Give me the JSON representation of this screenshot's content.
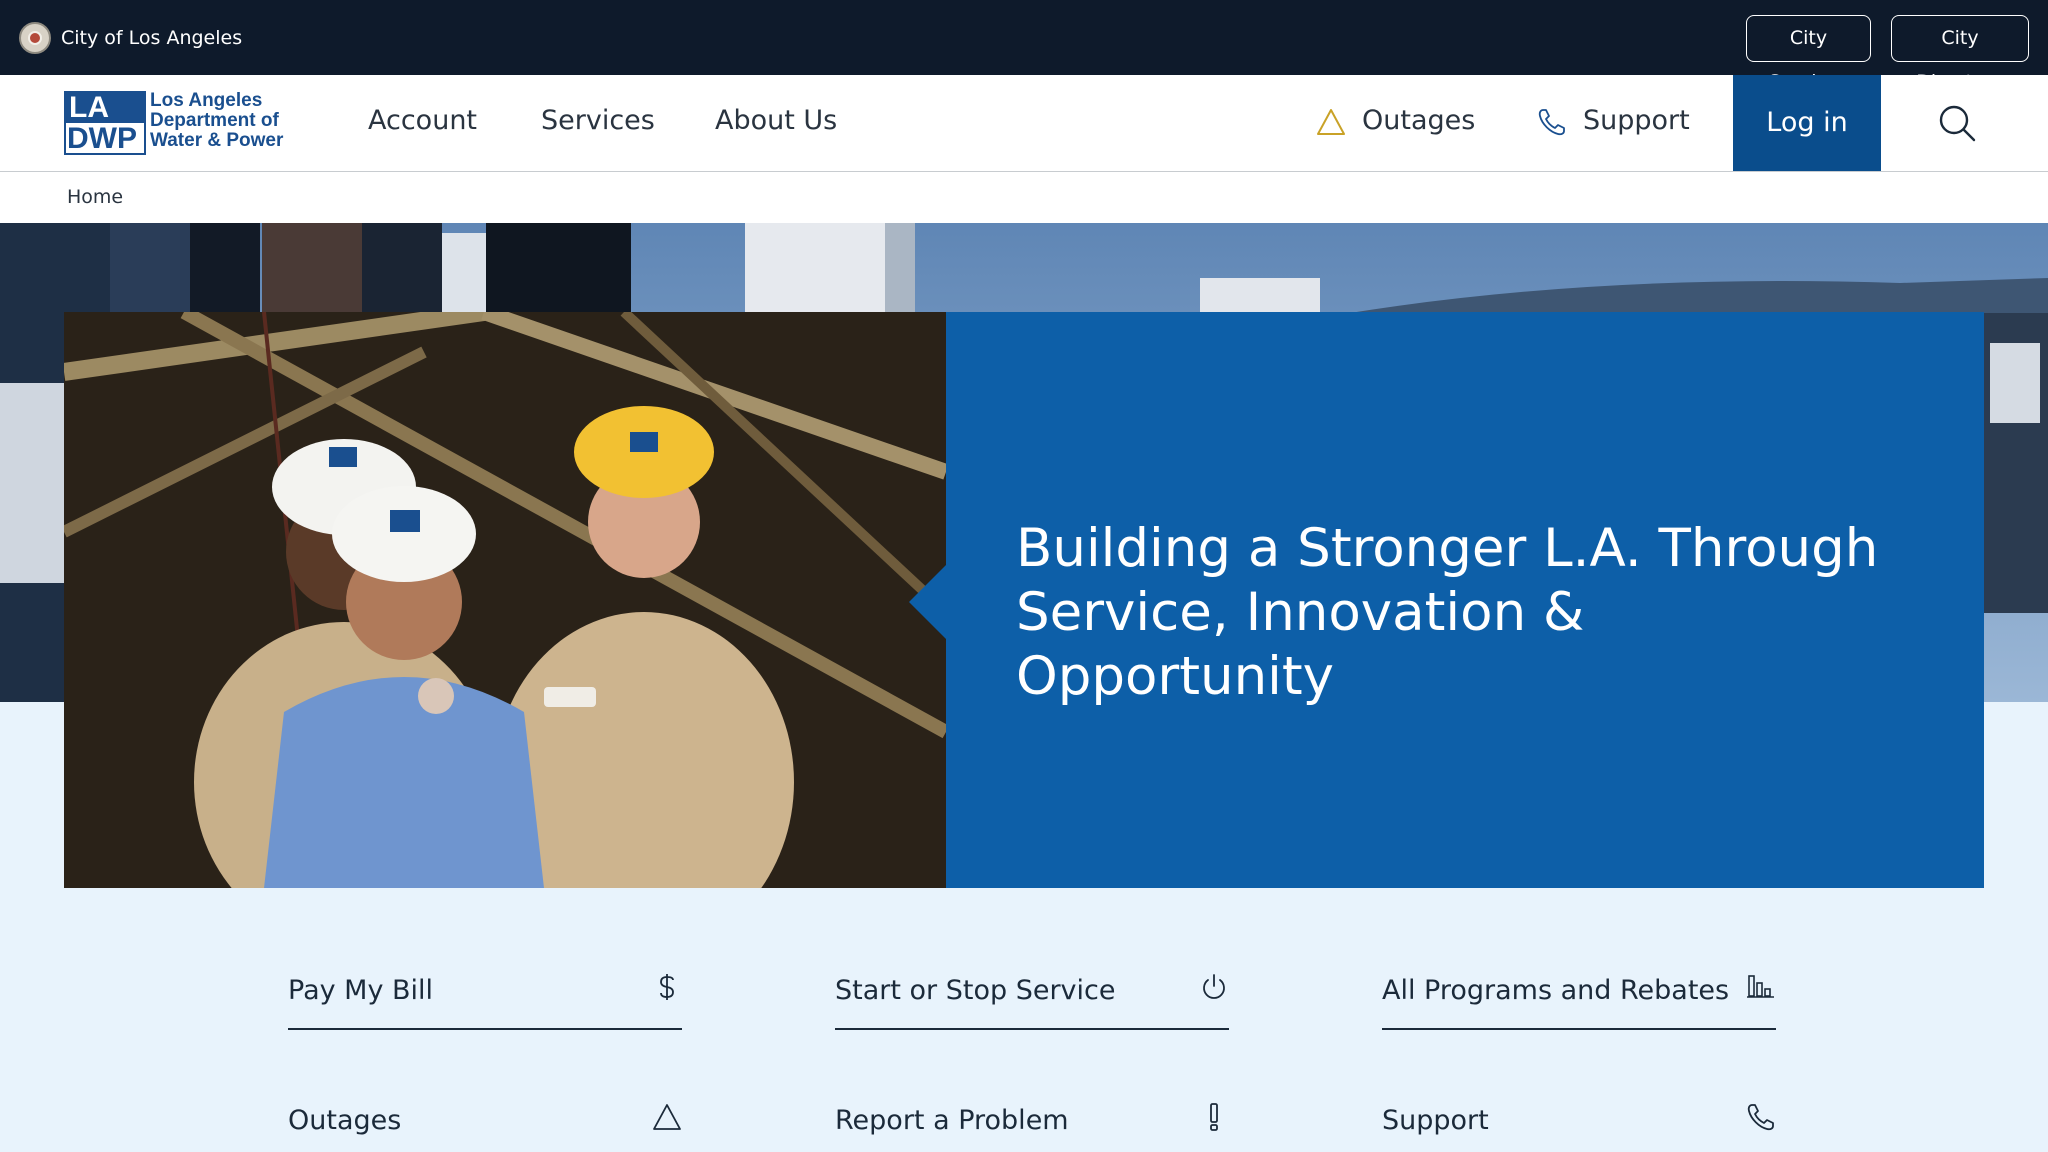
{
  "city_bar": {
    "name": "City of Los Angeles",
    "links": [
      "City Services",
      "City Directory"
    ]
  },
  "logo": {
    "mark_line1": "LA",
    "mark_line2": "DWP",
    "words": [
      "Los Angeles",
      "Department of",
      "Water & Power"
    ]
  },
  "nav": {
    "items": [
      "Account",
      "Services",
      "About Us"
    ],
    "outages": "Outages",
    "support": "Support",
    "login": "Log in"
  },
  "breadcrumb": "Home",
  "hero": {
    "title_line1": "Building a Stronger L.A. Through",
    "title_line2": "Service, Innovation & Opportunity"
  },
  "quick_links": [
    {
      "label": "Pay My Bill",
      "icon": "dollar-icon"
    },
    {
      "label": "Start or Stop Service",
      "icon": "power-icon"
    },
    {
      "label": "All Programs and Rebates",
      "icon": "bar-chart-icon"
    },
    {
      "label": "Outages",
      "icon": "warning-triangle-icon"
    },
    {
      "label": "Report a Problem",
      "icon": "exclamation-icon"
    },
    {
      "label": "Support",
      "icon": "phone-icon"
    }
  ],
  "colors": {
    "citybar_bg": "#0e1a2b",
    "brand_blue": "#0a4d8c",
    "hero_panel": "#0d5fa8",
    "page_bg": "#e8f3fc",
    "warning_accent": "#c9a227"
  }
}
